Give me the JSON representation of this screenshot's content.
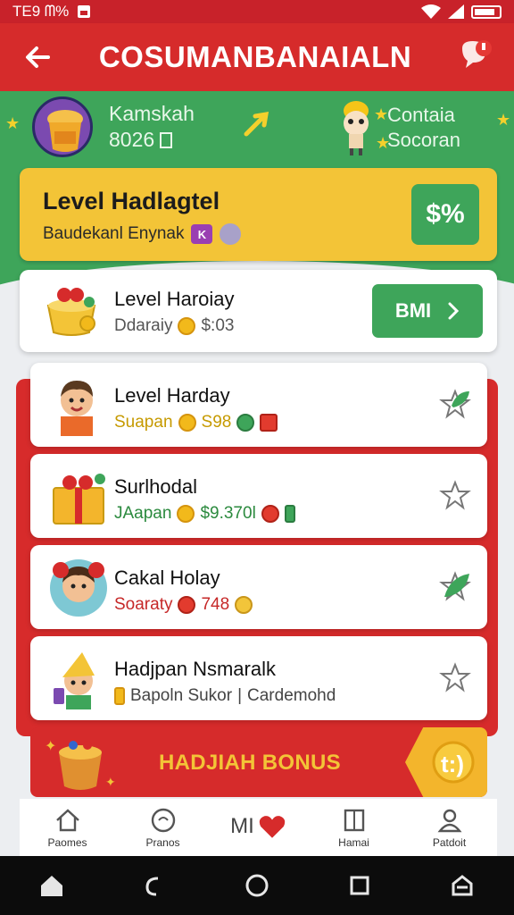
{
  "status": {
    "left_text": "TE9 ᗰ% ",
    "icons": [
      "image-icon",
      "wifi-icon",
      "signal-icon",
      "battery-icon"
    ]
  },
  "appbar": {
    "title": "COSUMANBANAIALN",
    "icons": [
      "back-arrow-icon",
      "notification-icon"
    ]
  },
  "user": {
    "name": "Kamskah",
    "points": "8026",
    "points_icon": "coin-box-icon"
  },
  "partner": {
    "name": "Contaia",
    "sub": "Socoran"
  },
  "level_card": {
    "title": "Level Hadlagtel",
    "subtitle": "Baudekanl Enynak",
    "badge": "K",
    "percent_button": "$%"
  },
  "featured": {
    "title": "Level Haroiay",
    "sub_label": "Ddaraiy",
    "sub_value": "$:03",
    "button": "BMI"
  },
  "items": [
    {
      "title": "Level Harday",
      "sub_label": "Suapan",
      "sub_value": "S98",
      "sub_color": "#c69a00",
      "fav": "leaf-star"
    },
    {
      "title": "Surlhodal",
      "sub_label": "JAapan",
      "sub_value": "$9.370l",
      "sub_color": "#2b8a3e",
      "fav": "star"
    },
    {
      "title": "Cakal Holay",
      "sub_label": "Soaraty",
      "sub_value": "748",
      "sub_color": "#c62828",
      "fav": "leaf-star"
    },
    {
      "title": "Hadjpan Nsmaralk",
      "sub_label": "Bapoln Sukor",
      "sub_value": "Cardemohd",
      "sub_color": "#444444",
      "fav": "star"
    }
  ],
  "bonus": {
    "label": "HADJIAH BONUS",
    "tag": "t:)"
  },
  "tabs": [
    {
      "label": "Paomes",
      "icon": "home-icon"
    },
    {
      "label": "Pranos",
      "icon": "circle-icon"
    },
    {
      "label": "MI",
      "icon": "heart-icon"
    },
    {
      "label": "Hamai",
      "icon": "book-icon"
    },
    {
      "label": "Patdoit",
      "icon": "profile-icon"
    }
  ],
  "colors": {
    "primary_red": "#d62b2b",
    "green": "#3ea55a",
    "yellow": "#f3c437"
  }
}
